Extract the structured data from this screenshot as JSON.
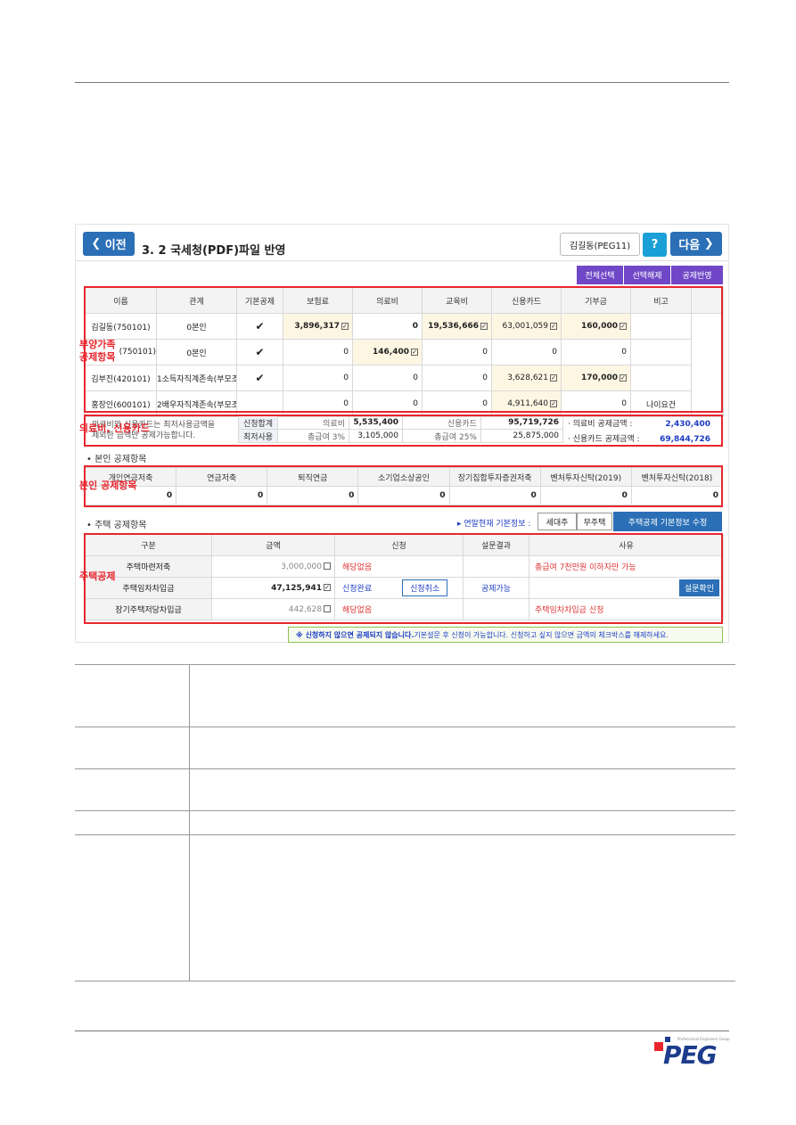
{
  "nav": {
    "prev": "이전",
    "next": "다음",
    "title": "3. 2  국세청(PDF)파일 반영",
    "user": "김길동(PEG11)",
    "help": "?"
  },
  "actions": [
    "전체선택",
    "선택해제",
    "공제반영"
  ],
  "dep": {
    "headers": [
      "이름",
      "관계",
      "기본공제",
      "보험료",
      "의료비",
      "교육비",
      "신용카드",
      "기부금",
      "비고"
    ],
    "rows": [
      [
        "김길동(750101)",
        "0본인",
        "✔",
        "3,896,317",
        "0",
        "19,536,666",
        "63,001,059",
        "160,000",
        ""
      ],
      [
        "(750101)",
        "0본인",
        "✔",
        "0",
        "146,400",
        "0",
        "0",
        "0",
        ""
      ],
      [
        "김부진(420101)",
        "1소득자직계존속(부모조",
        "✔",
        "0",
        "0",
        "0",
        "3,628,621",
        "170,000",
        ""
      ],
      [
        "홍장인(600101)",
        "2배우자직계존속(부모조",
        "",
        "0",
        "0",
        "0",
        "4,911,640",
        "0",
        "나이요건"
      ]
    ]
  },
  "med": {
    "note1": "의료비와 신용카드는 최저사용금액을",
    "note2": "제외한 금액만 공제가능합니다.",
    "r1": [
      "신청합계",
      "의료비",
      "5,535,400",
      "신용카드",
      "95,719,726"
    ],
    "r2": [
      "최저사용",
      "총급여 3%",
      "3,105,000",
      "총급여 25%",
      "25,875,000"
    ],
    "d1": "· 의료비 공제금액 :",
    "v1": "2,430,400",
    "d2": "· 신용카드 공제금액 :",
    "v2": "69,844,726"
  },
  "self": {
    "title": "• 본인 공제항목",
    "headers": [
      "개인연금저축",
      "연금저축",
      "퇴직연금",
      "소기업소상공인",
      "장기집합투자증권저축",
      "벤처투자신탁(2019)",
      "벤처투자신탁(2018)"
    ],
    "values": [
      "0",
      "0",
      "0",
      "0",
      "0",
      "0",
      "0"
    ]
  },
  "house": {
    "title": "• 주택 공제항목",
    "info": "▸ 연말현재 기본정보 :",
    "b1": "세대주",
    "b2": "무주택",
    "b3": "주택공제 기본정보 수정",
    "headers": [
      "구분",
      "금액",
      "신청",
      "설문결과",
      "사유"
    ],
    "rows": [
      {
        "name": "주택마련저축",
        "amount": "3,000,000",
        "apply": "해당없음",
        "btn": "",
        "survey": "",
        "reason": "총급여 7천만원 이하자만 가능",
        "rbtn": ""
      },
      {
        "name": "주택임차차입금",
        "amount": "47,125,941",
        "apply": "신청완료",
        "btn": "신청취소",
        "survey": "공제가능",
        "reason": "",
        "rbtn": "설문확인"
      },
      {
        "name": "장기주택저당차입금",
        "amount": "442,628",
        "apply": "해당없음",
        "btn": "",
        "survey": "",
        "reason": "주택임차차입금 신청",
        "rbtn": ""
      }
    ]
  },
  "notice": {
    "a": "※ 신청하지 않으면 공제되지 않습니다.",
    "b": " 기본설문 후 신청이 가능합니다. 신청하고 싶지 않으면 금액의 체크박스를 해제하세요."
  },
  "labels": {
    "l1a": "부양가족",
    "l1b": "공제항목",
    "l2": "의료비, 신용카드",
    "l3": "본인 공제항목",
    "l4": "주택공제"
  },
  "logo": {
    "text": "PEG",
    "sub": "Professional Engineers Group"
  },
  "colors": {
    "nav": "#2b6fb6",
    "purple": "#7047c6",
    "red": "#e8262e"
  }
}
